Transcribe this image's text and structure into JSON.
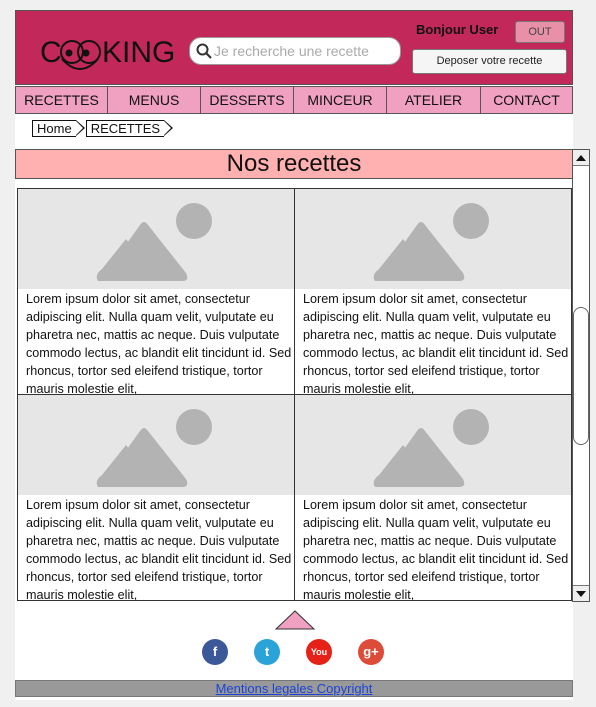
{
  "header": {
    "logo": {
      "text_before": "C",
      "text_after": "KING"
    },
    "search": {
      "placeholder": "Je recherche une recette"
    },
    "greeting": "Bonjour User",
    "out_label": "OUT",
    "deposer_label": "Deposer votre recette",
    "colors": {
      "header_bg": "#c2295a",
      "nav_bg": "#f0a0c0",
      "title_bg": "#ffb0b0"
    }
  },
  "nav": {
    "items": [
      {
        "label": "RECETTES"
      },
      {
        "label": "MENUS"
      },
      {
        "label": "DESSERTS"
      },
      {
        "label": "MINCEUR"
      },
      {
        "label": "ATELIER"
      },
      {
        "label": "CONTACT"
      }
    ]
  },
  "breadcrumb": {
    "items": [
      {
        "label": "Home"
      },
      {
        "label": "RECETTES"
      }
    ]
  },
  "main": {
    "title": "Nos recettes",
    "cards": [
      {
        "image": "placeholder-image-icon",
        "text": "Lorem ipsum dolor sit amet, consectetur adipiscing elit. Nulla quam velit, vulputate eu pharetra nec, mattis ac neque. Duis vulputate commodo lectus, ac blandit elit tincidunt id. Sed rhoncus, tortor sed eleifend tristique, tortor mauris molestie elit,"
      },
      {
        "image": "placeholder-image-icon",
        "text": "Lorem ipsum dolor sit amet, consectetur adipiscing elit. Nulla quam velit, vulputate eu pharetra nec, mattis ac neque. Duis vulputate commodo lectus, ac blandit elit tincidunt id. Sed rhoncus, tortor sed eleifend tristique, tortor mauris molestie elit,"
      },
      {
        "image": "placeholder-image-icon",
        "text": "Lorem ipsum dolor sit amet, consectetur adipiscing elit. Nulla quam velit, vulputate eu pharetra nec, mattis ac neque. Duis vulputate commodo lectus, ac blandit elit tincidunt id. Sed rhoncus, tortor sed eleifend tristique, tortor mauris molestie elit,"
      },
      {
        "image": "placeholder-image-icon",
        "text": "Lorem ipsum dolor sit amet, consectetur adipiscing elit. Nulla quam velit, vulputate eu pharetra nec, mattis ac neque. Duis vulputate commodo lectus, ac blandit elit tincidunt id. Sed rhoncus, tortor sed eleifend tristique, tortor mauris molestie elit,"
      }
    ]
  },
  "socials": [
    {
      "icon": "facebook-icon",
      "glyph": "f",
      "color": "#3b5998"
    },
    {
      "icon": "twitter-icon",
      "glyph": "t",
      "color": "#2aa3d8"
    },
    {
      "icon": "youtube-icon",
      "glyph": "You",
      "color": "#e62117"
    },
    {
      "icon": "google-plus-icon",
      "glyph": "g+",
      "color": "#dd4b39"
    }
  ],
  "footer": {
    "link_label": "Mentions legales  Copyright"
  }
}
